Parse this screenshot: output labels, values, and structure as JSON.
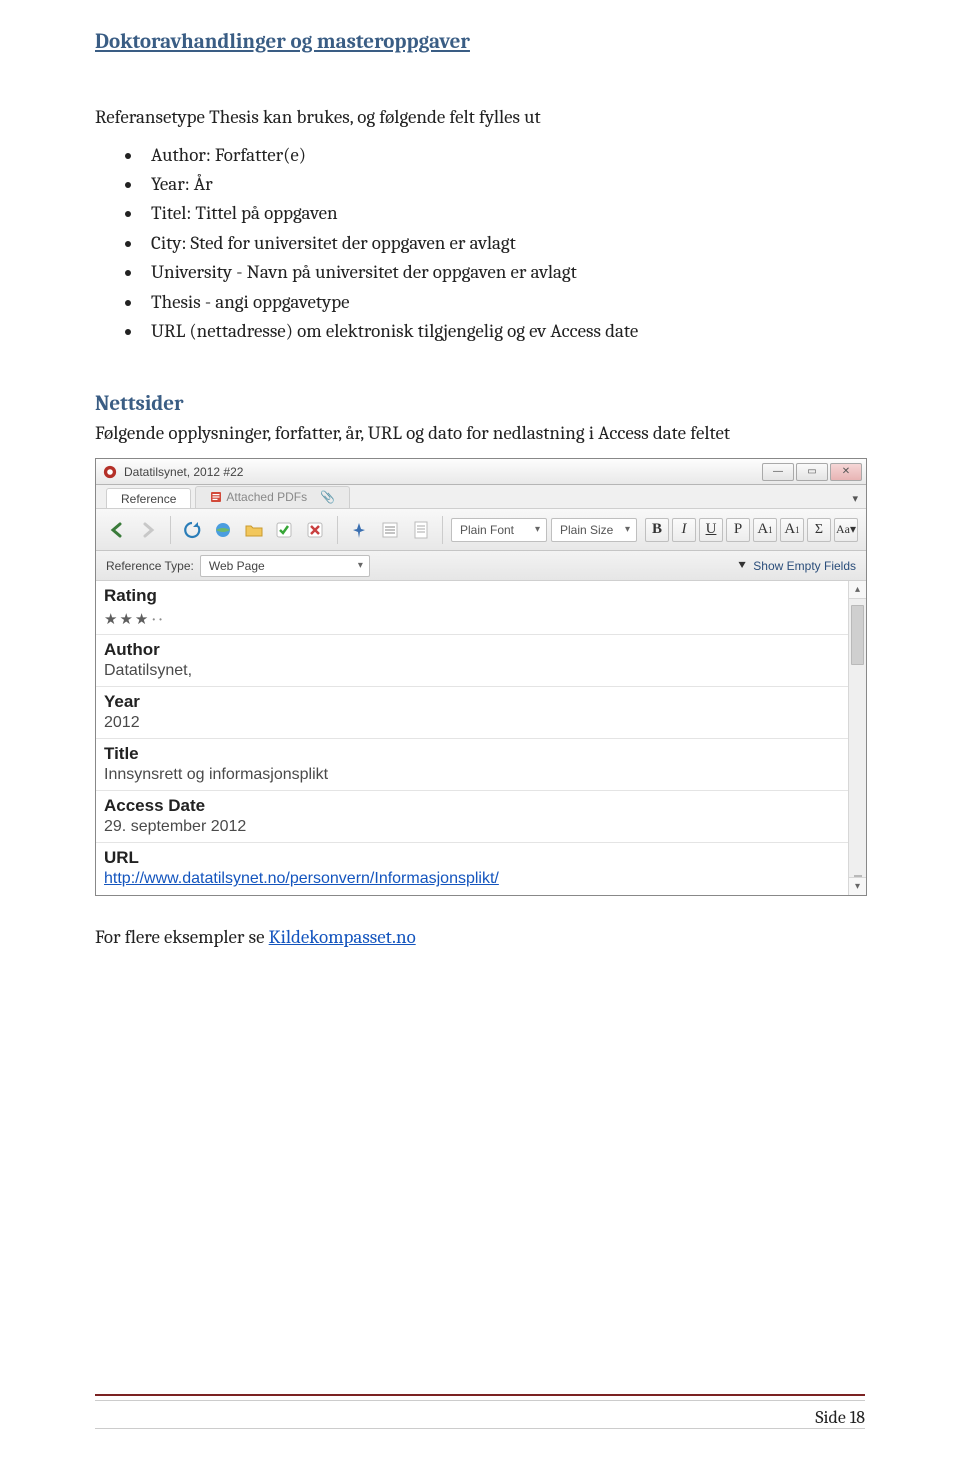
{
  "section1_title": "Doktoravhandlinger og masteroppgaver",
  "intro1": "Referansetype Thesis kan brukes, og følgende felt fylles ut",
  "bullets": [
    "Author: Forfatter(e)",
    "Year: År",
    "Titel: Tittel på oppgaven",
    "City: Sted for universitet der oppgaven er avlagt",
    "University - Navn på universitet der oppgaven er avlagt",
    "Thesis - angi oppgavetype",
    "URL (nettadresse) om elektronisk tilgjengelig og ev Access date"
  ],
  "section2_title": "Nettsider",
  "intro2": "Følgende opplysninger, forfatter, år, URL og dato for nedlastning i Access date feltet",
  "window": {
    "title": "Datatilsynet, 2012 #22",
    "tabs": {
      "reference": "Reference",
      "attached": "Attached PDFs"
    },
    "font": "Plain Font",
    "size": "Plain Size",
    "fmt": {
      "b": "B",
      "i": "I",
      "u": "U",
      "p": "P",
      "sup": "A",
      "sub": "A",
      "sigma": "Σ",
      "aa": "Aa"
    },
    "reftype_label": "Reference Type:",
    "reftype_value": "Web Page",
    "show_empty": "Show Empty Fields",
    "fields": {
      "rating_label": "Rating",
      "author_label": "Author",
      "author_value": "Datatilsynet,",
      "year_label": "Year",
      "year_value": "2012",
      "title_label": "Title",
      "title_value": "Innsynsrett og informasjonsplikt",
      "access_label": "Access Date",
      "access_value": "29. september 2012",
      "url_label": "URL",
      "url_value": "http://www.datatilsynet.no/personvern/Informasjonsplikt/"
    }
  },
  "footer_text_prefix": "For flere eksempler se ",
  "footer_link": "Kildekompasset.no",
  "page_number": "Side 18"
}
